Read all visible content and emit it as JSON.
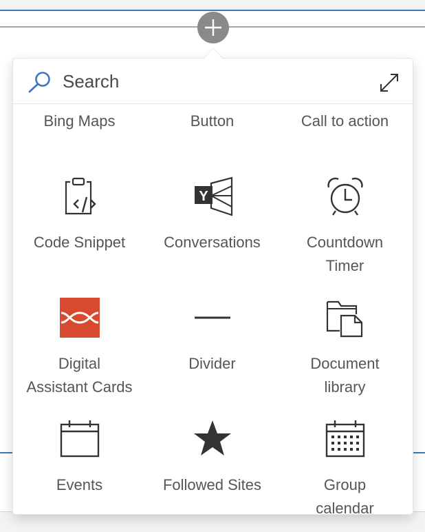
{
  "toolbox": {
    "search": {
      "placeholder": "Search"
    },
    "row0": {
      "bing_maps": "Bing Maps",
      "button": "Button",
      "call_to_action": "Call to action"
    },
    "row1": {
      "code_snippet": "Code Snippet",
      "conversations": "Conversations",
      "countdown_line1": "Countdown",
      "countdown_line2": "Timer"
    },
    "row2": {
      "digital_line1": "Digital",
      "digital_line2": "Assistant Cards",
      "divider": "Divider",
      "doclib_line1": "Document",
      "doclib_line2": "library"
    },
    "row3": {
      "events": "Events",
      "followed_sites": "Followed Sites",
      "group_line1": "Group",
      "group_line2": "calendar"
    },
    "yammer_letter": "Y"
  },
  "icons": [
    "add-icon",
    "search-icon",
    "expand-icon",
    "code-snippet-icon",
    "conversations-icon",
    "countdown-timer-icon",
    "digital-assistant-cards-icon",
    "divider-icon",
    "document-library-icon",
    "events-icon",
    "followed-sites-icon",
    "group-calendar-icon"
  ],
  "colors": {
    "accent_blue": "#3a78c5",
    "add_button_gray": "#8a8a8a",
    "digital_assistant_red": "#d84a2f",
    "icon_dark": "#333333"
  }
}
